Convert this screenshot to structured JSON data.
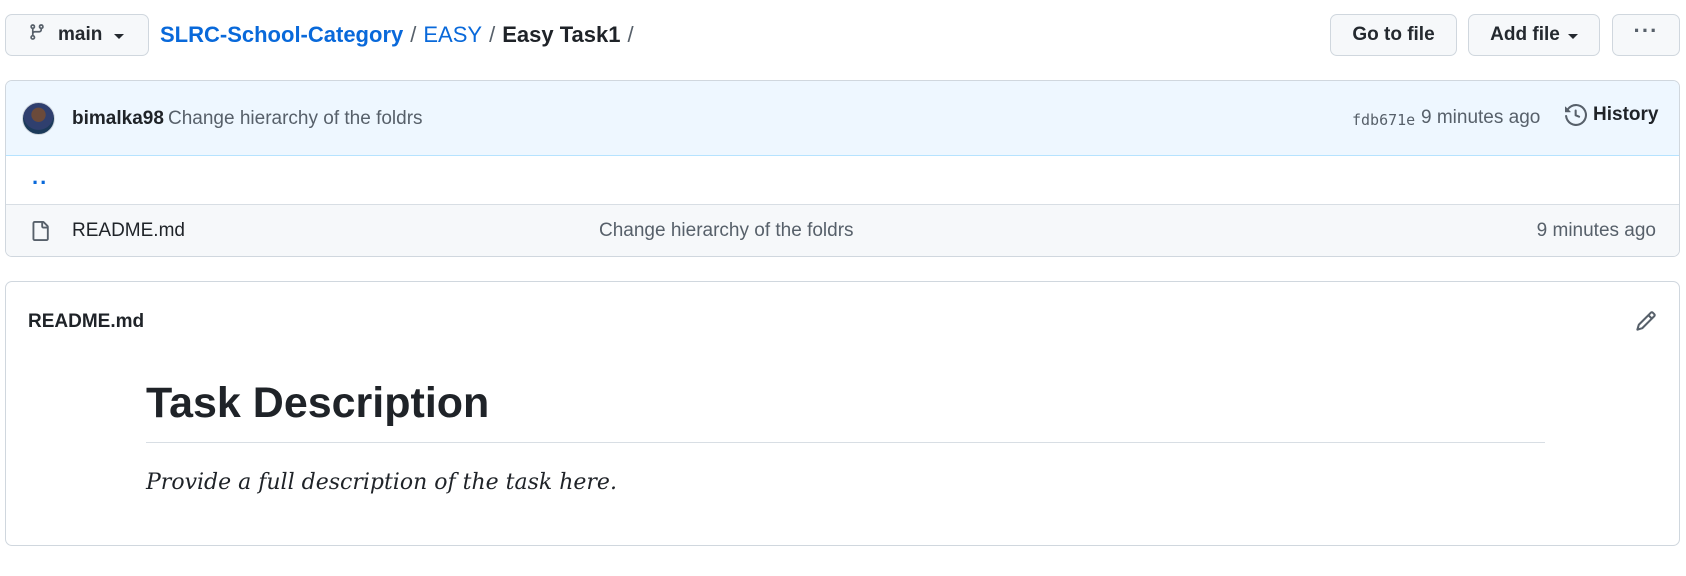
{
  "toolbar": {
    "branch_label": "main",
    "go_to_file_label": "Go to file",
    "add_file_label": "Add file",
    "more_label": "···"
  },
  "breadcrumb": {
    "repo": "SLRC-School-Category",
    "folder": "EASY",
    "current": "Easy Task1",
    "separator": "/"
  },
  "commit": {
    "author": "bimalka98",
    "message": "Change hierarchy of the foldrs",
    "sha": "fdb671e",
    "time": "9 minutes ago",
    "history_label": "History"
  },
  "files": {
    "parent_label": "..",
    "rows": [
      {
        "name": "README.md",
        "message": "Change hierarchy of the foldrs",
        "time": "9 minutes ago",
        "icon": "file-icon"
      }
    ]
  },
  "readme": {
    "filename": "README.md",
    "heading": "Task Description",
    "paragraph": "Provide a full description of the task here."
  },
  "colors": {
    "link": "#0969da",
    "commit_bg": "#eef7ff",
    "border": "#d0d7de",
    "text": "#1f2328",
    "muted": "#57606a"
  }
}
